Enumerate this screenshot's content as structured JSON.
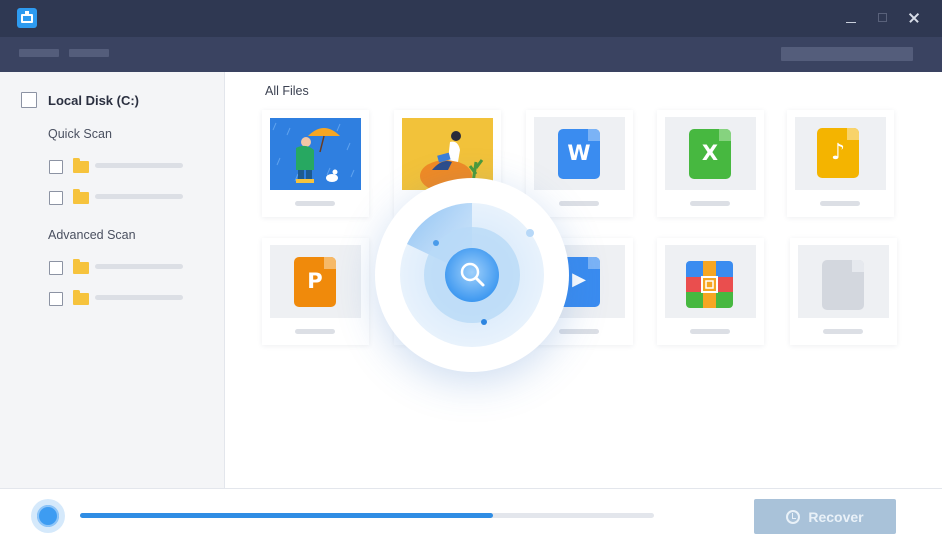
{
  "window": {
    "title": "",
    "controls": [
      "minimize-icon",
      "maximize-icon",
      "close-icon"
    ]
  },
  "sidebar": {
    "disk": {
      "label": "Local Disk (C:)",
      "checked": false
    },
    "sections": [
      {
        "label": "Quick Scan",
        "items": 2
      },
      {
        "label": "Advanced Scan",
        "items": 2
      }
    ]
  },
  "main": {
    "title": "All Files",
    "cards": [
      {
        "type": "image-thumbnail",
        "icon": "rain-illustration"
      },
      {
        "type": "image-thumbnail",
        "icon": "reading-illustration"
      },
      {
        "type": "document",
        "icon": "word-file-icon",
        "letter": "W",
        "color": "#3a8cf0"
      },
      {
        "type": "document",
        "icon": "excel-file-icon",
        "letter": "X",
        "color": "#47b840"
      },
      {
        "type": "document",
        "icon": "audio-file-icon",
        "letter": "♪",
        "color": "#f4b400"
      },
      {
        "type": "document",
        "icon": "powerpoint-file-icon",
        "letter": "P",
        "color": "#f08a0b"
      },
      {
        "type": "document",
        "icon": "video-file-icon",
        "letter": "▶",
        "color": "#3a8cf0"
      },
      {
        "type": "document",
        "icon": "archive-file-icon",
        "letter": "",
        "color": "#ea4e4e"
      },
      {
        "type": "document",
        "icon": "unknown-file-icon",
        "letter": "",
        "color": "#d3d7de"
      }
    ]
  },
  "footer": {
    "progress": 0.72,
    "recover_label": "Recover",
    "recover_enabled": false
  },
  "colors": {
    "titlebar": "#2f3852",
    "toolbar": "#3a4361",
    "accent": "#2f8de4",
    "recover_disabled": "#a9c2d9"
  }
}
